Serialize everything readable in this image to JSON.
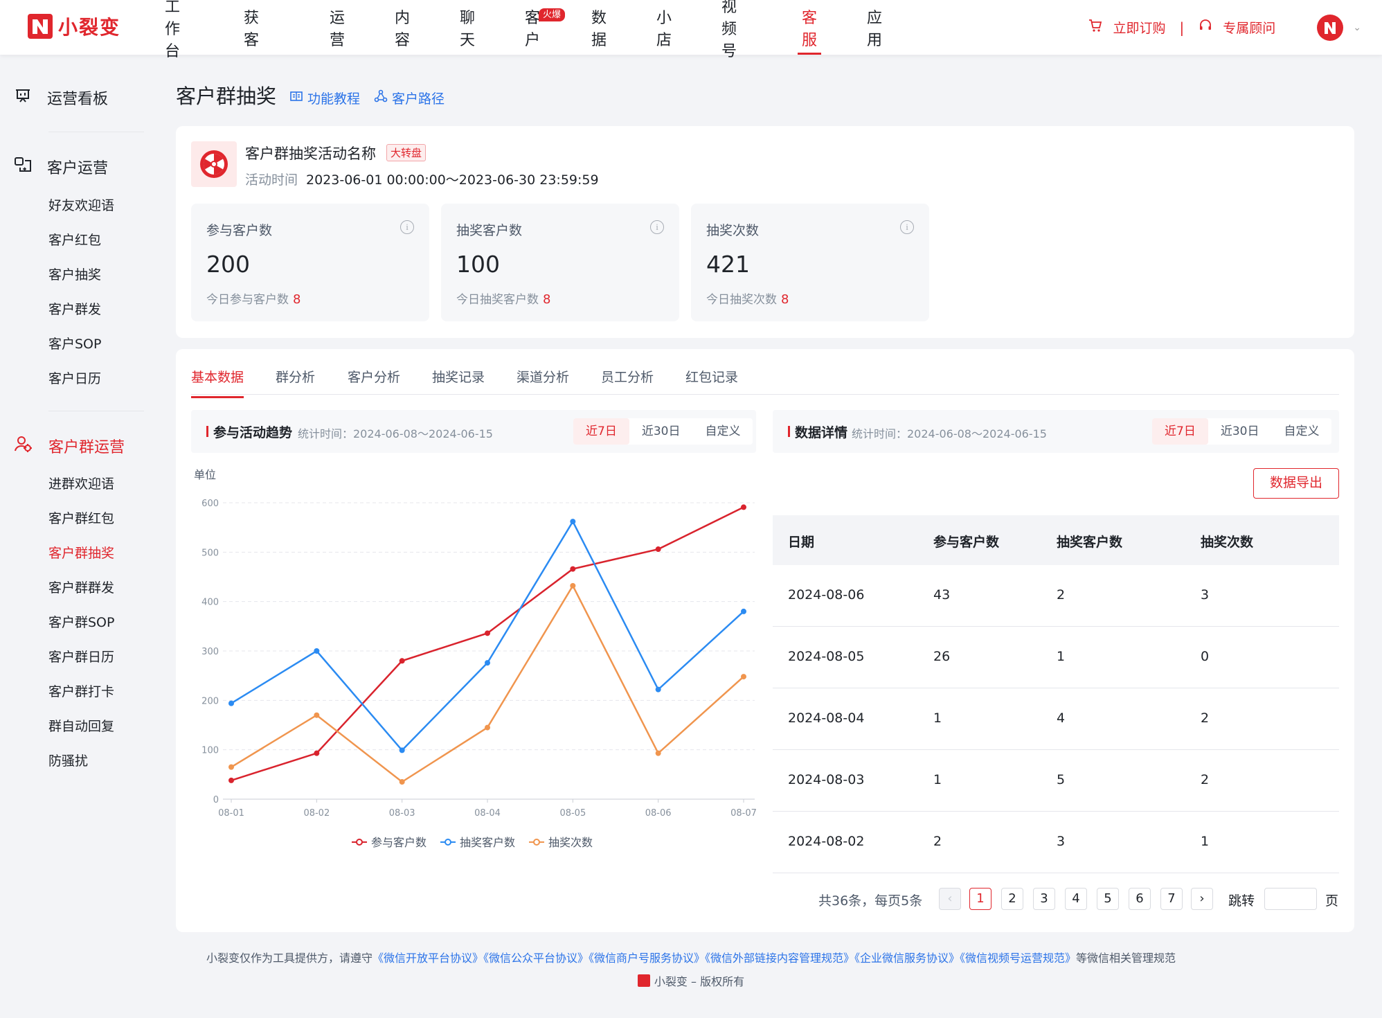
{
  "brand": {
    "name": "小裂变",
    "accent": "#e0262d",
    "link": "#2b73e8"
  },
  "nav": {
    "items": [
      "工作台",
      "获客",
      "运营",
      "内容",
      "聊天",
      "客户",
      "数据",
      "小店",
      "视频号",
      "客服",
      "应用"
    ],
    "active": "客服",
    "badge": {
      "item": "客户",
      "text": "火爆"
    }
  },
  "top_right": {
    "order": "立即订购",
    "advisor": "专属顾问"
  },
  "sidebar": {
    "group1": "运营看板",
    "group2": "客户运营",
    "group2_items": [
      "好友欢迎语",
      "客户红包",
      "客户抽奖",
      "客户群发",
      "客户SOP",
      "客户日历"
    ],
    "group3": "客户群运营",
    "group3_items": [
      "进群欢迎语",
      "客户群红包",
      "客户群抽奖",
      "客户群群发",
      "客户群SOP",
      "客户群日历",
      "客户群打卡",
      "群自动回复",
      "防骚扰"
    ],
    "active_item": "客户群抽奖"
  },
  "page": {
    "title": "客户群抽奖",
    "tutorial": "功能教程",
    "path": "客户路径"
  },
  "activity": {
    "name": "客户群抽奖活动名称",
    "tag": "大转盘",
    "time_label": "活动时间",
    "time": "2023-06-01 00:00:00～2023-06-30 23:59:59"
  },
  "stats": [
    {
      "label": "参与客户数",
      "value": "200",
      "sub": "今日参与客户数",
      "today": "8"
    },
    {
      "label": "抽奖客户数",
      "value": "100",
      "sub": "今日抽奖客户数",
      "today": "8"
    },
    {
      "label": "抽奖次数",
      "value": "421",
      "sub": "今日抽奖次数",
      "today": "8"
    }
  ],
  "tabs": [
    "基本数据",
    "群分析",
    "客户分析",
    "抽奖记录",
    "渠道分析",
    "员工分析",
    "红包记录"
  ],
  "trend": {
    "title": "参与活动趋势",
    "range": "统计时间：2024-06-08～2024-06-15",
    "ranges": [
      "近7日",
      "近30日",
      "自定义"
    ],
    "unit": "单位"
  },
  "detail": {
    "title": "数据详情",
    "range": "统计时间：2024-06-08～2024-06-15",
    "ranges": [
      "近7日",
      "近30日",
      "自定义"
    ],
    "export": "数据导出",
    "columns": [
      "日期",
      "参与客户数",
      "抽奖客户数",
      "抽奖次数"
    ],
    "rows": [
      [
        "2024-08-06",
        "43",
        "2",
        "3"
      ],
      [
        "2024-08-05",
        "26",
        "1",
        "0"
      ],
      [
        "2024-08-04",
        "1",
        "4",
        "2"
      ],
      [
        "2024-08-03",
        "1",
        "5",
        "2"
      ],
      [
        "2024-08-02",
        "2",
        "3",
        "1"
      ]
    ]
  },
  "pager": {
    "total": "共36条，每页5条",
    "pages": [
      "1",
      "2",
      "3",
      "4",
      "5",
      "6",
      "7"
    ],
    "current": "1",
    "jump": "跳转",
    "page_unit": "页"
  },
  "footer": {
    "prefix": "小裂变仅作为工具提供方，请遵守",
    "links": [
      "《微信开放平台协议》",
      "《微信公众平台协议》",
      "《微信商户号服务协议》",
      "《微信外部链接内容管理规范》",
      "《企业微信服务协议》",
      "《微信视频号运营规范》"
    ],
    "suffix": "等微信相关管理规范",
    "copyright": "小裂变 – 版权所有"
  },
  "chart_data": {
    "type": "line",
    "categories": [
      "08-01",
      "08-02",
      "08-03",
      "08-04",
      "08-05",
      "08-06",
      "08-07"
    ],
    "ylim": [
      0,
      600
    ],
    "yticks": [
      0,
      100,
      200,
      300,
      400,
      500,
      600
    ],
    "ylabel": "单位",
    "grid": true,
    "legend": "bottom",
    "series": [
      {
        "name": "参与客户数",
        "color": "#d9232d",
        "values": [
          38,
          93,
          280,
          336,
          466,
          506,
          591
        ]
      },
      {
        "name": "抽奖客户数",
        "color": "#2b8bf2",
        "values": [
          194,
          300,
          99,
          276,
          562,
          222,
          380
        ]
      },
      {
        "name": "抽奖次数",
        "color": "#f0954e",
        "values": [
          65,
          170,
          35,
          145,
          432,
          93,
          248
        ]
      }
    ]
  }
}
